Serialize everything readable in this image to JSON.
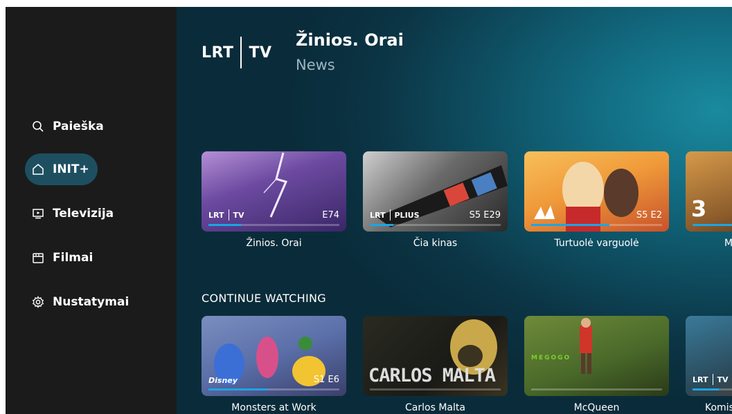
{
  "sidebar": {
    "items": [
      {
        "label": "Paieška",
        "icon": "search-icon"
      },
      {
        "label": "INIT+",
        "icon": "home-icon",
        "active": true
      },
      {
        "label": "Televizija",
        "icon": "tv-icon"
      },
      {
        "label": "Filmai",
        "icon": "film-icon"
      },
      {
        "label": "Nustatymai",
        "icon": "gear-icon"
      }
    ]
  },
  "hero": {
    "channel_logo": "LRT | TV",
    "title": "Žinios. Orai",
    "subtitle": "News"
  },
  "row1": {
    "cards": [
      {
        "title": "Žinios. Orai",
        "brand": "LRT | TV",
        "episode": "E74",
        "progress": 0.25
      },
      {
        "title": "Čia kinas",
        "brand": "LRT | PLIUS",
        "episode": "S5 E29",
        "progress": 0.18
      },
      {
        "title": "Turtuolė varguolė",
        "brand": "",
        "episode": "S5 E2",
        "progress": 0.6
      },
      {
        "title": "M",
        "brand": "3",
        "episode": "",
        "progress": 0.3
      }
    ]
  },
  "row2": {
    "heading": "CONTINUE WATCHING",
    "cards": [
      {
        "title": "Monsters at Work",
        "brand": "Disney CHANNEL",
        "episode": "S1 E6",
        "progress": 0.45
      },
      {
        "title": "Carlos Malta",
        "overlay": "CARLOS MALTA",
        "episode": "",
        "progress": 0.0
      },
      {
        "title": "McQueen",
        "brand": "MEGOGO",
        "episode": "",
        "progress": 0.0
      },
      {
        "title": "Komis",
        "brand": "LRT | TV",
        "episode": "",
        "progress": 0.2
      }
    ]
  },
  "colors": {
    "sidebar": "#1b1b1b",
    "active_pill": "#1e4f60",
    "progress": "#1aa6e6"
  }
}
